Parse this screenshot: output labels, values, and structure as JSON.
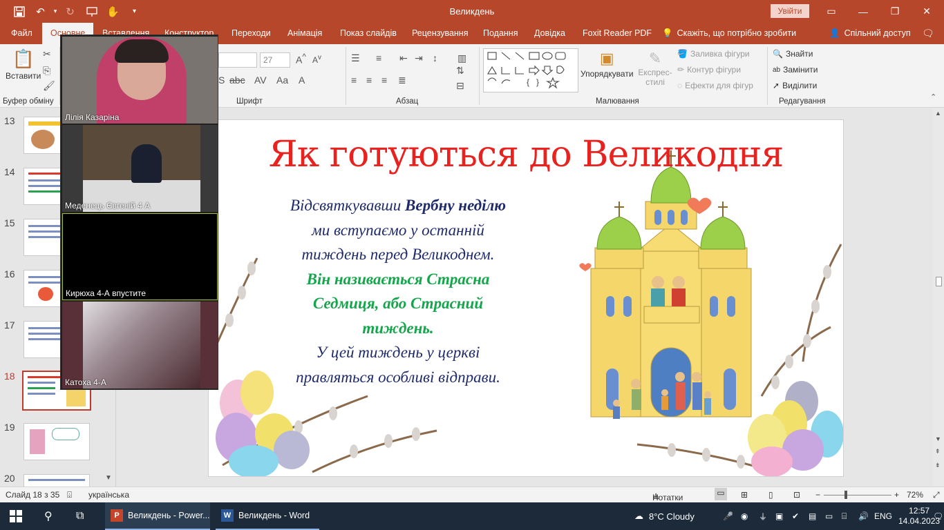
{
  "window": {
    "title": "Великдень",
    "sign_in": "Увійти"
  },
  "tabs": [
    "Файл",
    "Основне",
    "Вставлення",
    "Конструктор",
    "Переходи",
    "Анімація",
    "Показ слайдів",
    "Рецензування",
    "Подання",
    "Довідка",
    "Foxit Reader PDF"
  ],
  "tell_me": "Скажіть, що потрібно зробити",
  "share": "Спільний доступ",
  "ribbon": {
    "paste": "Вставити",
    "clipboard_label": "Буфер обміну",
    "font_size": "27",
    "font_label": "Шрифт",
    "paragraph_label": "Абзац",
    "arrange": "Упорядкувати",
    "quick_styles": "Експрес-стилі",
    "shape_fill": "Заливка фігури",
    "shape_outline": "Контур фігури",
    "shape_effects": "Ефекти для фігур",
    "drawing_label": "Малювання",
    "find": "Знайти",
    "replace": "Замінити",
    "select": "Виділити",
    "editing_label": "Редагування"
  },
  "thumbnails": {
    "numbers": [
      "13",
      "14",
      "15",
      "16",
      "17",
      "18",
      "19",
      "20"
    ],
    "active": "18"
  },
  "video": {
    "participants": [
      "Лілія Казаріна",
      "Меденець Євгеній 4 А",
      "Кирюха 4-А впустите",
      "Катоха 4-А"
    ]
  },
  "slide": {
    "title": "Як готуються до Великодня",
    "line1_a": "Відсвяткувавши ",
    "line1_b": "Вербну неділю",
    "line2": "ми вступаємо у останній",
    "line3": "тиждень перед Великоднем.",
    "line4": "Він називається Страсна",
    "line5": "Седмиця, або Страсний",
    "line6": "тиждень.",
    "line7": "У цей тиждень у церкві",
    "line8": "правляться особливі відправи."
  },
  "status": {
    "slide_count": "Слайд 18 з 35",
    "language": "українська",
    "notes": "Нотатки",
    "zoom": "72%"
  },
  "taskbar": {
    "powerpoint": "Великдень - Power...",
    "word": "Великдень - Word",
    "weather": "8°C  Cloudy",
    "lang": "ENG",
    "time": "12:57",
    "date": "14.04.2023"
  },
  "colors": {
    "accent": "#b7472a",
    "title_red": "#e8231f",
    "text_blue": "#1f2a6b",
    "text_green": "#14a64a"
  }
}
